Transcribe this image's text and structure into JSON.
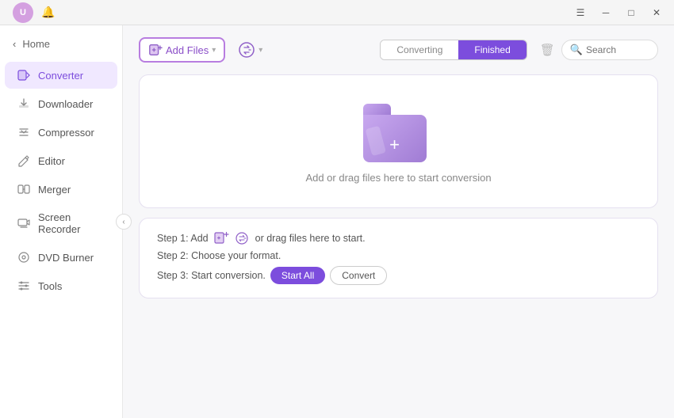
{
  "titlebar": {
    "user_icon_label": "U",
    "bell_icon": "🔔",
    "menu_icon": "☰",
    "minimize_icon": "─",
    "maximize_icon": "□",
    "close_icon": "✕"
  },
  "sidebar": {
    "home_label": "Home",
    "items": [
      {
        "id": "converter",
        "label": "Converter",
        "active": true
      },
      {
        "id": "downloader",
        "label": "Downloader",
        "active": false
      },
      {
        "id": "compressor",
        "label": "Compressor",
        "active": false
      },
      {
        "id": "editor",
        "label": "Editor",
        "active": false
      },
      {
        "id": "merger",
        "label": "Merger",
        "active": false
      },
      {
        "id": "screen-recorder",
        "label": "Screen Recorder",
        "active": false
      },
      {
        "id": "dvd-burner",
        "label": "DVD Burner",
        "active": false
      },
      {
        "id": "tools",
        "label": "Tools",
        "active": false
      }
    ]
  },
  "toolbar": {
    "add_button_label": "Add Files",
    "convert_tool_label": "",
    "tabs": [
      {
        "id": "converting",
        "label": "Converting",
        "active": false
      },
      {
        "id": "finished",
        "label": "Finished",
        "active": true
      }
    ],
    "search_placeholder": "Search"
  },
  "dropzone": {
    "text": "Add or drag files here to start conversion"
  },
  "steps": {
    "step1_prefix": "Step 1: Add",
    "step1_suffix": "or drag files here to start.",
    "step2": "Step 2: Choose your format.",
    "step3_prefix": "Step 3: Start conversion.",
    "start_all_label": "Start All",
    "convert_label": "Convert"
  }
}
